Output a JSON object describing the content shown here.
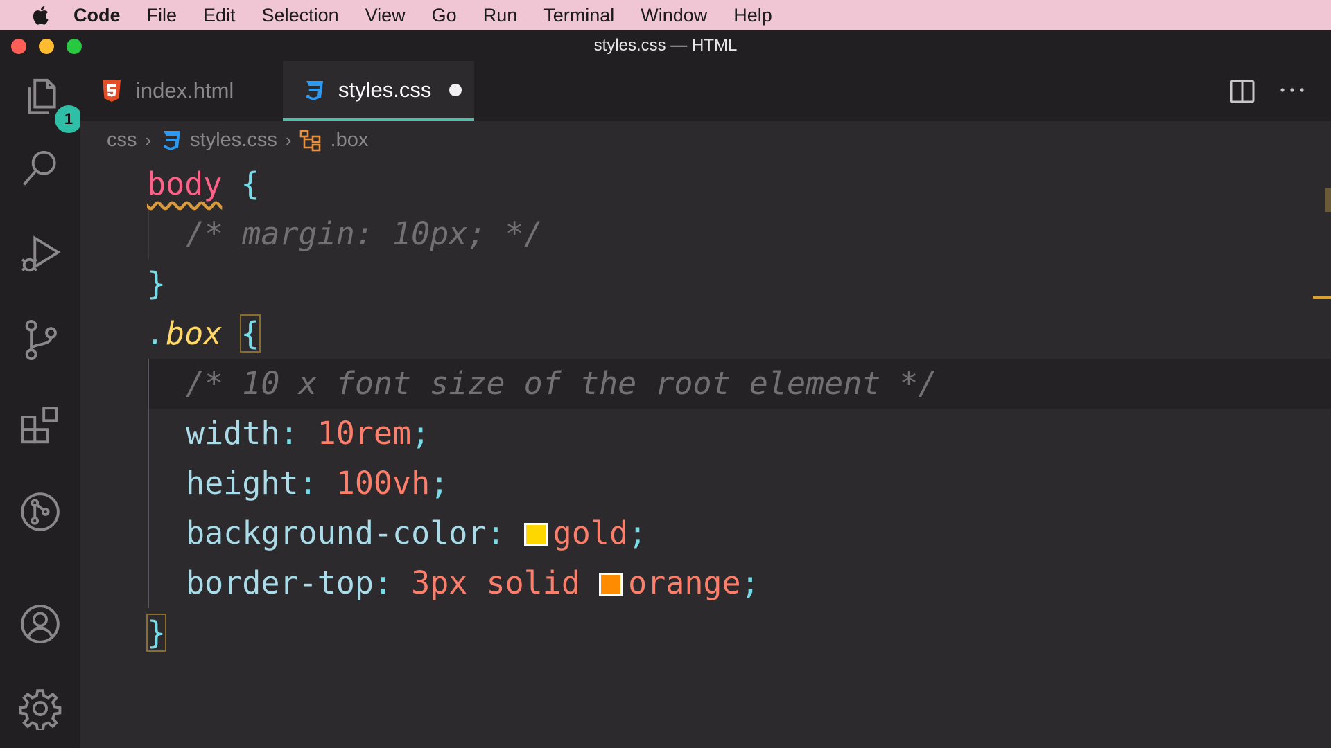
{
  "menubar": {
    "app": "Code",
    "items": [
      "File",
      "Edit",
      "Selection",
      "View",
      "Go",
      "Run",
      "Terminal",
      "Window",
      "Help"
    ]
  },
  "window": {
    "title": "styles.css — HTML"
  },
  "activitybar": {
    "icons": [
      "files-icon",
      "search-icon",
      "run-debug-icon",
      "source-control-icon",
      "extensions-icon",
      "git-graph-icon",
      "account-icon",
      "settings-gear-icon"
    ],
    "explorer_badge": "1"
  },
  "tabs": [
    {
      "label": "index.html",
      "icon": "html5-icon",
      "active": false
    },
    {
      "label": "styles.css",
      "icon": "css3-icon",
      "active": true,
      "dirty": true
    }
  ],
  "breadcrumb": {
    "folder": "css",
    "file": "styles.css",
    "symbol": ".box"
  },
  "code": {
    "l1_selector": "body",
    "l1_brace": "{",
    "l2_comment": "/* margin: 10px; */",
    "l3_brace": "}",
    "l4_dot": ".",
    "l4_class": "box",
    "l4_brace": "{",
    "l5_comment": "/* 10 x font size of the root element */",
    "l6_prop": "width",
    "l6_value": "10rem",
    "l7_prop": "height",
    "l7_value": "100vh",
    "l8_prop": "background-color",
    "l8_value": "gold",
    "l9_prop": "border-top",
    "l9_value_a": "3px solid",
    "l9_value_b": "orange",
    "l10_brace": "}",
    "colon": ":",
    "semicolon": ";"
  },
  "colors": {
    "gold": "#ffd700",
    "orange": "#ff8c00",
    "accent": "#44c4b0"
  }
}
